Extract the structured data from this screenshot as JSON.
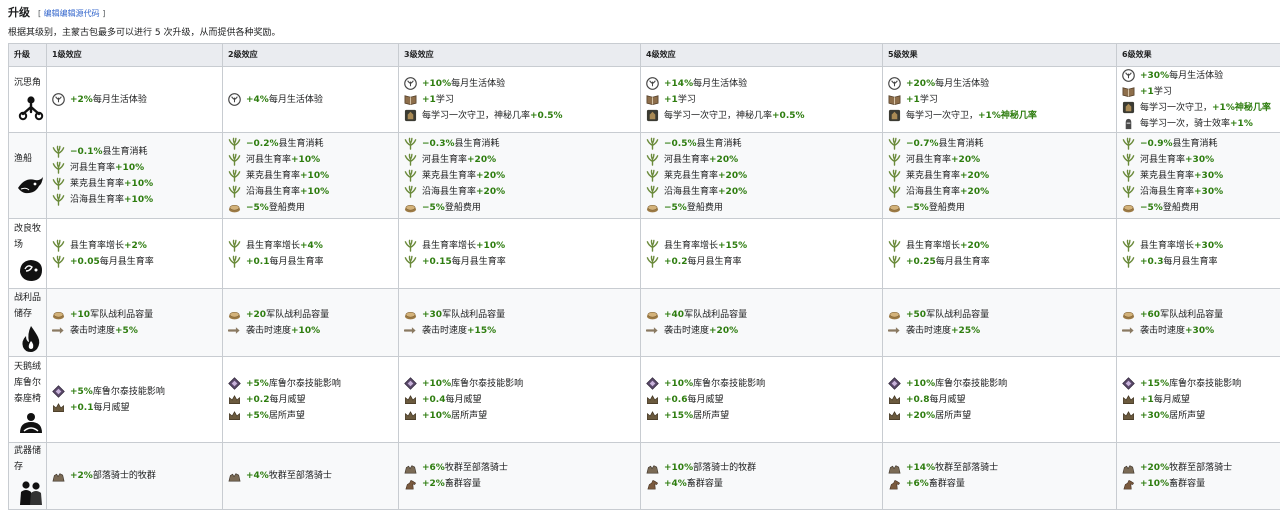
{
  "title": "升级",
  "edit": {
    "open": "[",
    "link": "编辑",
    "link2": "编辑源代码",
    "close": "]"
  },
  "intro": "根据其级别，主蒙古包最多可以进行 5 次升级，从而提供各种奖励。",
  "headers": [
    "升级",
    "1级效应",
    "2级效应",
    "3级效应",
    "4级效应",
    "5级效果",
    "6级效果"
  ],
  "rows": [
    {
      "name": "沉思角",
      "icon": "meditation-icon",
      "levels": [
        [
          {
            "icon": "lifestyle",
            "pre": "",
            "val": "+2%",
            "post": "每月生活体验"
          }
        ],
        [
          {
            "icon": "lifestyle",
            "pre": "",
            "val": "+4%",
            "post": "每月生活体验"
          }
        ],
        [
          {
            "icon": "lifestyle",
            "pre": "",
            "val": "+10%",
            "post": "每月生活体验"
          },
          {
            "icon": "book",
            "pre": "",
            "val": "+1",
            "post": "学习"
          },
          {
            "icon": "guard",
            "pre": "每学习一次守卫，神秘几率",
            "val": "+0.5%",
            "post": ""
          }
        ],
        [
          {
            "icon": "lifestyle",
            "pre": "",
            "val": "+14%",
            "post": "每月生活体验"
          },
          {
            "icon": "book",
            "pre": "",
            "val": "+1",
            "post": "学习"
          },
          {
            "icon": "guard",
            "pre": "每学习一次守卫，神秘几率",
            "val": "+0.5%",
            "post": ""
          }
        ],
        [
          {
            "icon": "lifestyle",
            "pre": "",
            "val": "+20%",
            "post": "每月生活体验"
          },
          {
            "icon": "book",
            "pre": "",
            "val": "+1",
            "post": "学习"
          },
          {
            "icon": "guard",
            "pre": "每学习一次守卫，",
            "val": "+1%神秘几率",
            "post": ""
          }
        ],
        [
          {
            "icon": "lifestyle",
            "pre": "",
            "val": "+30%",
            "post": "每月生活体验"
          },
          {
            "icon": "book",
            "pre": "",
            "val": "+1",
            "post": "学习"
          },
          {
            "icon": "guard",
            "pre": "每学习一次守卫，",
            "val": "+1%神秘几率",
            "post": ""
          },
          {
            "icon": "knight",
            "pre": "每学习一次，骑士效率",
            "val": "+1%",
            "post": ""
          }
        ]
      ]
    },
    {
      "name": "渔船",
      "icon": "fish-icon",
      "levels": [
        [
          {
            "icon": "plant",
            "pre": "",
            "val": "−0.1%",
            "post": "县生育消耗"
          },
          {
            "icon": "plant",
            "pre": "河县生育率",
            "val": "+10%",
            "post": ""
          },
          {
            "icon": "plant",
            "pre": "莱克县生育率",
            "val": "+10%",
            "post": ""
          },
          {
            "icon": "plant",
            "pre": "沿海县生育率",
            "val": "+10%",
            "post": ""
          }
        ],
        [
          {
            "icon": "plant",
            "pre": "",
            "val": "−0.2%",
            "post": "县生育消耗"
          },
          {
            "icon": "plant",
            "pre": "河县生育率",
            "val": "+10%",
            "post": ""
          },
          {
            "icon": "plant",
            "pre": "莱克县生育率",
            "val": "+10%",
            "post": ""
          },
          {
            "icon": "plant",
            "pre": "沿海县生育率",
            "val": "+10%",
            "post": ""
          },
          {
            "icon": "coin",
            "pre": "",
            "val": "−5%",
            "post": "登船费用"
          }
        ],
        [
          {
            "icon": "plant",
            "pre": "",
            "val": "−0.3%",
            "post": "县生育消耗"
          },
          {
            "icon": "plant",
            "pre": "河县生育率",
            "val": "+20%",
            "post": ""
          },
          {
            "icon": "plant",
            "pre": "莱克县生育率",
            "val": "+20%",
            "post": ""
          },
          {
            "icon": "plant",
            "pre": "沿海县生育率",
            "val": "+20%",
            "post": ""
          },
          {
            "icon": "coin",
            "pre": "",
            "val": "−5%",
            "post": "登船费用"
          }
        ],
        [
          {
            "icon": "plant",
            "pre": "",
            "val": "−0.5%",
            "post": "县生育消耗"
          },
          {
            "icon": "plant",
            "pre": "河县生育率",
            "val": "+20%",
            "post": ""
          },
          {
            "icon": "plant",
            "pre": "莱克县生育率",
            "val": "+20%",
            "post": ""
          },
          {
            "icon": "plant",
            "pre": "沿海县生育率",
            "val": "+20%",
            "post": ""
          },
          {
            "icon": "coin",
            "pre": "",
            "val": "−5%",
            "post": "登船费用"
          }
        ],
        [
          {
            "icon": "plant",
            "pre": "",
            "val": "−0.7%",
            "post": "县生育消耗"
          },
          {
            "icon": "plant",
            "pre": "河县生育率",
            "val": "+20%",
            "post": ""
          },
          {
            "icon": "plant",
            "pre": "莱克县生育率",
            "val": "+20%",
            "post": ""
          },
          {
            "icon": "plant",
            "pre": "沿海县生育率",
            "val": "+20%",
            "post": ""
          },
          {
            "icon": "coin",
            "pre": "",
            "val": "−5%",
            "post": "登船费用"
          }
        ],
        [
          {
            "icon": "plant",
            "pre": "",
            "val": "−0.9%",
            "post": "县生育消耗"
          },
          {
            "icon": "plant",
            "pre": "河县生育率",
            "val": "+30%",
            "post": ""
          },
          {
            "icon": "plant",
            "pre": "莱克县生育率",
            "val": "+30%",
            "post": ""
          },
          {
            "icon": "plant",
            "pre": "沿海县生育率",
            "val": "+30%",
            "post": ""
          },
          {
            "icon": "coin",
            "pre": "",
            "val": "−5%",
            "post": "登船费用"
          }
        ]
      ]
    },
    {
      "name": "改良牧场",
      "icon": "ram-icon",
      "levels": [
        [
          {
            "icon": "plant",
            "pre": "县生育率增长",
            "val": "+2%",
            "post": ""
          },
          {
            "icon": "plant",
            "pre": "",
            "val": "+0.05",
            "post": "每月县生育率"
          }
        ],
        [
          {
            "icon": "plant",
            "pre": "县生育率增长",
            "val": "+4%",
            "post": ""
          },
          {
            "icon": "plant",
            "pre": "",
            "val": "+0.1",
            "post": "每月县生育率"
          }
        ],
        [
          {
            "icon": "plant",
            "pre": "县生育率增长",
            "val": "+10%",
            "post": ""
          },
          {
            "icon": "plant",
            "pre": "",
            "val": "+0.15",
            "post": "每月县生育率"
          }
        ],
        [
          {
            "icon": "plant",
            "pre": "县生育率增长",
            "val": "+15%",
            "post": ""
          },
          {
            "icon": "plant",
            "pre": "",
            "val": "+0.2",
            "post": "每月县生育率"
          }
        ],
        [
          {
            "icon": "plant",
            "pre": "县生育率增长",
            "val": "+20%",
            "post": ""
          },
          {
            "icon": "plant",
            "pre": "",
            "val": "+0.25",
            "post": "每月县生育率"
          }
        ],
        [
          {
            "icon": "plant",
            "pre": "县生育率增长",
            "val": "+30%",
            "post": ""
          },
          {
            "icon": "plant",
            "pre": "",
            "val": "+0.3",
            "post": "每月县生育率"
          }
        ]
      ]
    },
    {
      "name": "战利品储存",
      "icon": "fire-icon",
      "levels": [
        [
          {
            "icon": "coin",
            "pre": "",
            "val": "+10",
            "post": "军队战利品容量"
          },
          {
            "icon": "arrow",
            "pre": "袭击时速度",
            "val": "+5%",
            "post": ""
          }
        ],
        [
          {
            "icon": "coin",
            "pre": "",
            "val": "+20",
            "post": "军队战利品容量"
          },
          {
            "icon": "arrow",
            "pre": "袭击时速度",
            "val": "+10%",
            "post": ""
          }
        ],
        [
          {
            "icon": "coin",
            "pre": "",
            "val": "+30",
            "post": "军队战利品容量"
          },
          {
            "icon": "arrow",
            "pre": "袭击时速度",
            "val": "+15%",
            "post": ""
          }
        ],
        [
          {
            "icon": "coin",
            "pre": "",
            "val": "+40",
            "post": "军队战利品容量"
          },
          {
            "icon": "arrow",
            "pre": "袭击时速度",
            "val": "+20%",
            "post": ""
          }
        ],
        [
          {
            "icon": "coin",
            "pre": "",
            "val": "+50",
            "post": "军队战利品容量"
          },
          {
            "icon": "arrow",
            "pre": "袭击时速度",
            "val": "+25%",
            "post": ""
          }
        ],
        [
          {
            "icon": "coin",
            "pre": "",
            "val": "+60",
            "post": "军队战利品容量"
          },
          {
            "icon": "arrow",
            "pre": "袭击时速度",
            "val": "+30%",
            "post": ""
          }
        ]
      ]
    },
    {
      "name": "天鹅绒库鲁尔泰座椅",
      "icon": "chair-icon",
      "levels": [
        [
          {
            "icon": "diamond",
            "pre": "",
            "val": "+5%",
            "post": "库鲁尔泰技能影响"
          },
          {
            "icon": "crown",
            "pre": "",
            "val": "+0.1",
            "post": "每月威望"
          }
        ],
        [
          {
            "icon": "diamond",
            "pre": "",
            "val": "+5%",
            "post": "库鲁尔泰技能影响"
          },
          {
            "icon": "crown",
            "pre": "",
            "val": "+0.2",
            "post": "每月威望"
          },
          {
            "icon": "crown",
            "pre": "",
            "val": "+5%",
            "post": "居所声望"
          }
        ],
        [
          {
            "icon": "diamond",
            "pre": "",
            "val": "+10%",
            "post": "库鲁尔泰技能影响"
          },
          {
            "icon": "crown",
            "pre": "",
            "val": "+0.4",
            "post": "每月威望"
          },
          {
            "icon": "crown",
            "pre": "",
            "val": "+10%",
            "post": "居所声望"
          }
        ],
        [
          {
            "icon": "diamond",
            "pre": "",
            "val": "+10%",
            "post": "库鲁尔泰技能影响"
          },
          {
            "icon": "crown",
            "pre": "",
            "val": "+0.6",
            "post": "每月威望"
          },
          {
            "icon": "crown",
            "pre": "",
            "val": "+15%",
            "post": "居所声望"
          }
        ],
        [
          {
            "icon": "diamond",
            "pre": "",
            "val": "+10%",
            "post": "库鲁尔泰技能影响"
          },
          {
            "icon": "crown",
            "pre": "",
            "val": "+0.8",
            "post": "每月威望"
          },
          {
            "icon": "crown",
            "pre": "",
            "val": "+20%",
            "post": "居所声望"
          }
        ],
        [
          {
            "icon": "diamond",
            "pre": "",
            "val": "+15%",
            "post": "库鲁尔泰技能影响"
          },
          {
            "icon": "crown",
            "pre": "",
            "val": "+1",
            "post": "每月威望"
          },
          {
            "icon": "crown",
            "pre": "",
            "val": "+30%",
            "post": "居所声望"
          }
        ]
      ]
    },
    {
      "name": "武器储存",
      "icon": "warriors-icon",
      "levels": [
        [
          {
            "icon": "herd",
            "pre": "",
            "val": "+2%",
            "post": "部落骑士的牧群"
          }
        ],
        [
          {
            "icon": "herd",
            "pre": "",
            "val": "+4%",
            "post": "牧群至部落骑士"
          }
        ],
        [
          {
            "icon": "herd",
            "pre": "",
            "val": "+6%",
            "post": "牧群至部落骑士"
          },
          {
            "icon": "horse",
            "pre": "",
            "val": "+2%",
            "post": "畜群容量"
          }
        ],
        [
          {
            "icon": "herd",
            "pre": "",
            "val": "+10%",
            "post": "部落骑士的牧群"
          },
          {
            "icon": "horse",
            "pre": "",
            "val": "+4%",
            "post": "畜群容量"
          }
        ],
        [
          {
            "icon": "herd",
            "pre": "",
            "val": "+14%",
            "post": "牧群至部落骑士"
          },
          {
            "icon": "horse",
            "pre": "",
            "val": "+6%",
            "post": "畜群容量"
          }
        ],
        [
          {
            "icon": "herd",
            "pre": "",
            "val": "+20%",
            "post": "牧群至部落骑士"
          },
          {
            "icon": "horse",
            "pre": "",
            "val": "+10%",
            "post": "畜群容量"
          }
        ]
      ]
    }
  ],
  "colors": {
    "positive": "#2e7d0f",
    "link": "#3366cc",
    "header_bg": "#eaecf0",
    "border": "#c8ccd1"
  }
}
